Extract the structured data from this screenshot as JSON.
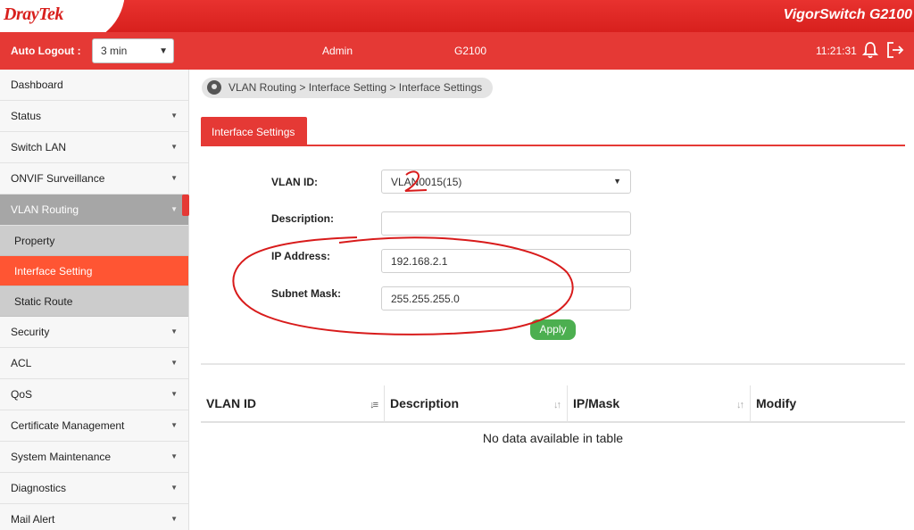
{
  "brand": {
    "logo": "DrayTek",
    "product": "VigorSwitch G2100"
  },
  "header": {
    "auto_logout_label": "Auto Logout :",
    "auto_logout_value": "3 min",
    "user": "Admin",
    "model": "G2100",
    "time": "11:21:31"
  },
  "sidebar": {
    "items": [
      {
        "label": "Dashboard"
      },
      {
        "label": "Status"
      },
      {
        "label": "Switch LAN"
      },
      {
        "label": "ONVIF Surveillance"
      },
      {
        "label": "VLAN Routing"
      },
      {
        "label": "Property"
      },
      {
        "label": "Interface Setting"
      },
      {
        "label": "Static Route"
      },
      {
        "label": "Security"
      },
      {
        "label": "ACL"
      },
      {
        "label": "QoS"
      },
      {
        "label": "Certificate Management"
      },
      {
        "label": "System Maintenance"
      },
      {
        "label": "Diagnostics"
      },
      {
        "label": "Mail Alert"
      }
    ]
  },
  "breadcrumb": "VLAN Routing > Interface Setting  > Interface Settings",
  "tab": "Interface Settings",
  "form": {
    "vlan_id_label": "VLAN ID:",
    "vlan_id_value": "VLAN0015(15)",
    "description_label": "Description:",
    "description_value": "",
    "ip_label": "IP Address:",
    "ip_value": "192.168.2.1",
    "mask_label": "Subnet Mask:",
    "mask_value": "255.255.255.0",
    "apply_label": "Apply"
  },
  "table": {
    "columns": [
      "VLAN ID",
      "Description",
      "IP/Mask",
      "Modify"
    ],
    "empty_message": "No data available in table"
  },
  "colors": {
    "brand_red": "#e53935",
    "active_nav": "#ff5533",
    "apply_green": "#4caf50",
    "annotation": "#d81b1b"
  }
}
